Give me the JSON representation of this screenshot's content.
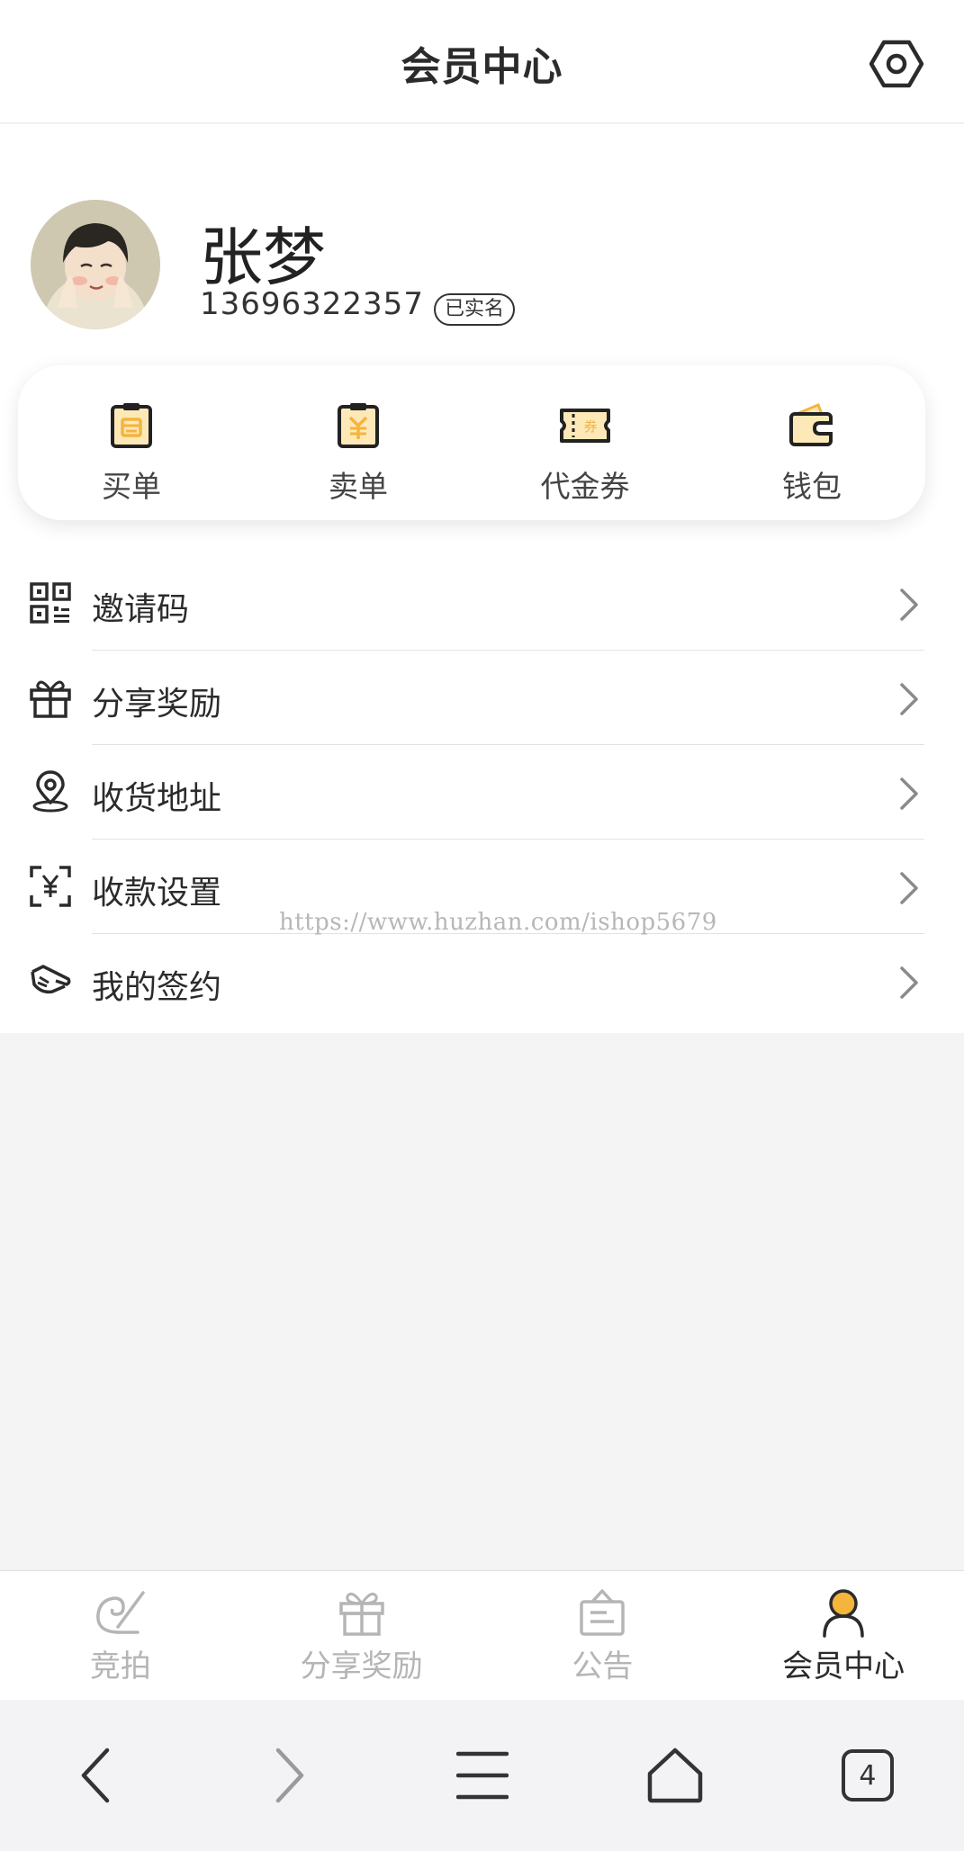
{
  "header": {
    "title": "会员中心",
    "settings_icon": "settings-hexagon-icon"
  },
  "profile": {
    "name": "张梦",
    "phone": "13696322357",
    "verified_badge": "已实名"
  },
  "quick_actions": [
    {
      "label": "买单",
      "icon": "buy-order-icon"
    },
    {
      "label": "卖单",
      "icon": "sell-order-icon"
    },
    {
      "label": "代金券",
      "icon": "voucher-icon"
    },
    {
      "label": "钱包",
      "icon": "wallet-icon"
    }
  ],
  "menu": [
    {
      "label": "邀请码",
      "icon": "qr-code-icon"
    },
    {
      "label": "分享奖励",
      "icon": "gift-icon"
    },
    {
      "label": "收货地址",
      "icon": "location-pin-icon"
    },
    {
      "label": "收款设置",
      "icon": "payment-scan-icon"
    },
    {
      "label": "我的签约",
      "icon": "sign-hand-icon"
    }
  ],
  "watermark": "https://www.huzhan.com/ishop5679",
  "tabbar": [
    {
      "label": "竞拍",
      "icon": "auction-icon",
      "active": false
    },
    {
      "label": "分享奖励",
      "icon": "gift-icon",
      "active": false
    },
    {
      "label": "公告",
      "icon": "notice-icon",
      "active": false
    },
    {
      "label": "会员中心",
      "icon": "member-icon",
      "active": true
    }
  ],
  "browser": {
    "tabs_count": "4"
  },
  "colors": {
    "accent": "#f5b43c",
    "accent_light": "#fde9b8"
  }
}
